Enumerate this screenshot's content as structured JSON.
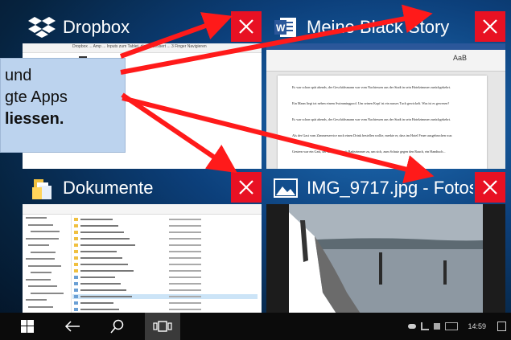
{
  "windows": [
    {
      "title": "Dropbox",
      "icon": "dropbox-icon",
      "preview": "Dropbox ... Amp ... Inputs zum Tablet, die verbessert ... 3 Finger Navigieren"
    },
    {
      "title": "Meine Black Story",
      "icon": "word-icon",
      "preview_text": [
        "Es war schon spät abends, der Geschäftsmann war vom Nachtessen aus der Stadt in sein Hotelzimmer zurückgekehrt.",
        "Ein Mann liegt tot neben einem Swimmingpool. Um seinen Kopf ist ein nasses Tuch gewickelt. Was ist es gewesen?",
        "Es war schon spät abends, der Geschäftsmann war vom Nachtessen aus der Stadt in sein Hotelzimmer zurückgekehrt.",
        "Als der Gast vom Zimmerservice noch einen Drink bestellen wollte, merkte er, dass im Hotel Feuer ausgebrochen war.",
        "Gestern war ein Gast, der die Mann nach Badezimmer zu, um sich, zum Schutz gegen den Rauch, ein Handtuch..."
      ]
    },
    {
      "title": "Dokumente",
      "icon": "folder-icon"
    },
    {
      "title": "IMG_9717.jpg - Fotos",
      "icon": "photos-icon"
    }
  ],
  "callout": {
    "line1": "und",
    "line2": "gte Apps",
    "line3": "liessen."
  },
  "taskbar": {
    "clock": "14:59",
    "start": "windows-icon",
    "back": "back-arrow-icon",
    "search": "search-icon",
    "taskview": "task-view-icon"
  },
  "colors": {
    "close": "#e81123",
    "arrow": "#ff1a1a",
    "callout_bg": "#bcd3ee"
  }
}
